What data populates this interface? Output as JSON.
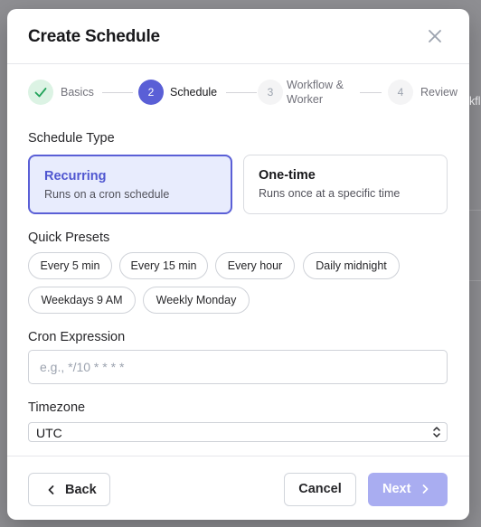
{
  "dialog": {
    "title": "Create Schedule",
    "close_label": "×"
  },
  "stepper": {
    "steps": [
      {
        "number": "1",
        "label": "Basics",
        "state": "completed"
      },
      {
        "number": "2",
        "label": "Schedule",
        "state": "active"
      },
      {
        "number": "3",
        "label_line1": "Workflow &",
        "label_line2": "Worker",
        "state": "pending"
      },
      {
        "number": "4",
        "label": "Review",
        "state": "pending"
      }
    ],
    "overflow_text": "kfl"
  },
  "schedule_type": {
    "label": "Schedule Type",
    "options": [
      {
        "title": "Recurring",
        "description": "Runs on a cron schedule",
        "selected": true
      },
      {
        "title": "One-time",
        "description": "Runs once at a specific time",
        "selected": false
      }
    ]
  },
  "quick_presets": {
    "label": "Quick Presets",
    "items": [
      "Every 5 min",
      "Every 15 min",
      "Every hour",
      "Daily midnight",
      "Weekdays 9 AM",
      "Weekly Monday"
    ]
  },
  "cron": {
    "label": "Cron Expression",
    "value": "",
    "placeholder": "e.g., */10 * * * *"
  },
  "timezone": {
    "label": "Timezone",
    "selected": "UTC"
  },
  "footer": {
    "back_label": "Back",
    "cancel_label": "Cancel",
    "next_label": "Next"
  },
  "colors": {
    "accent": "#5a5fd6",
    "selected_card_bg": "#e8ecfd",
    "completed_green": "#22a35a",
    "completed_bg": "#dcf3e4",
    "next_disabled": "#a9adf1",
    "backdrop": "#8f8f93"
  }
}
